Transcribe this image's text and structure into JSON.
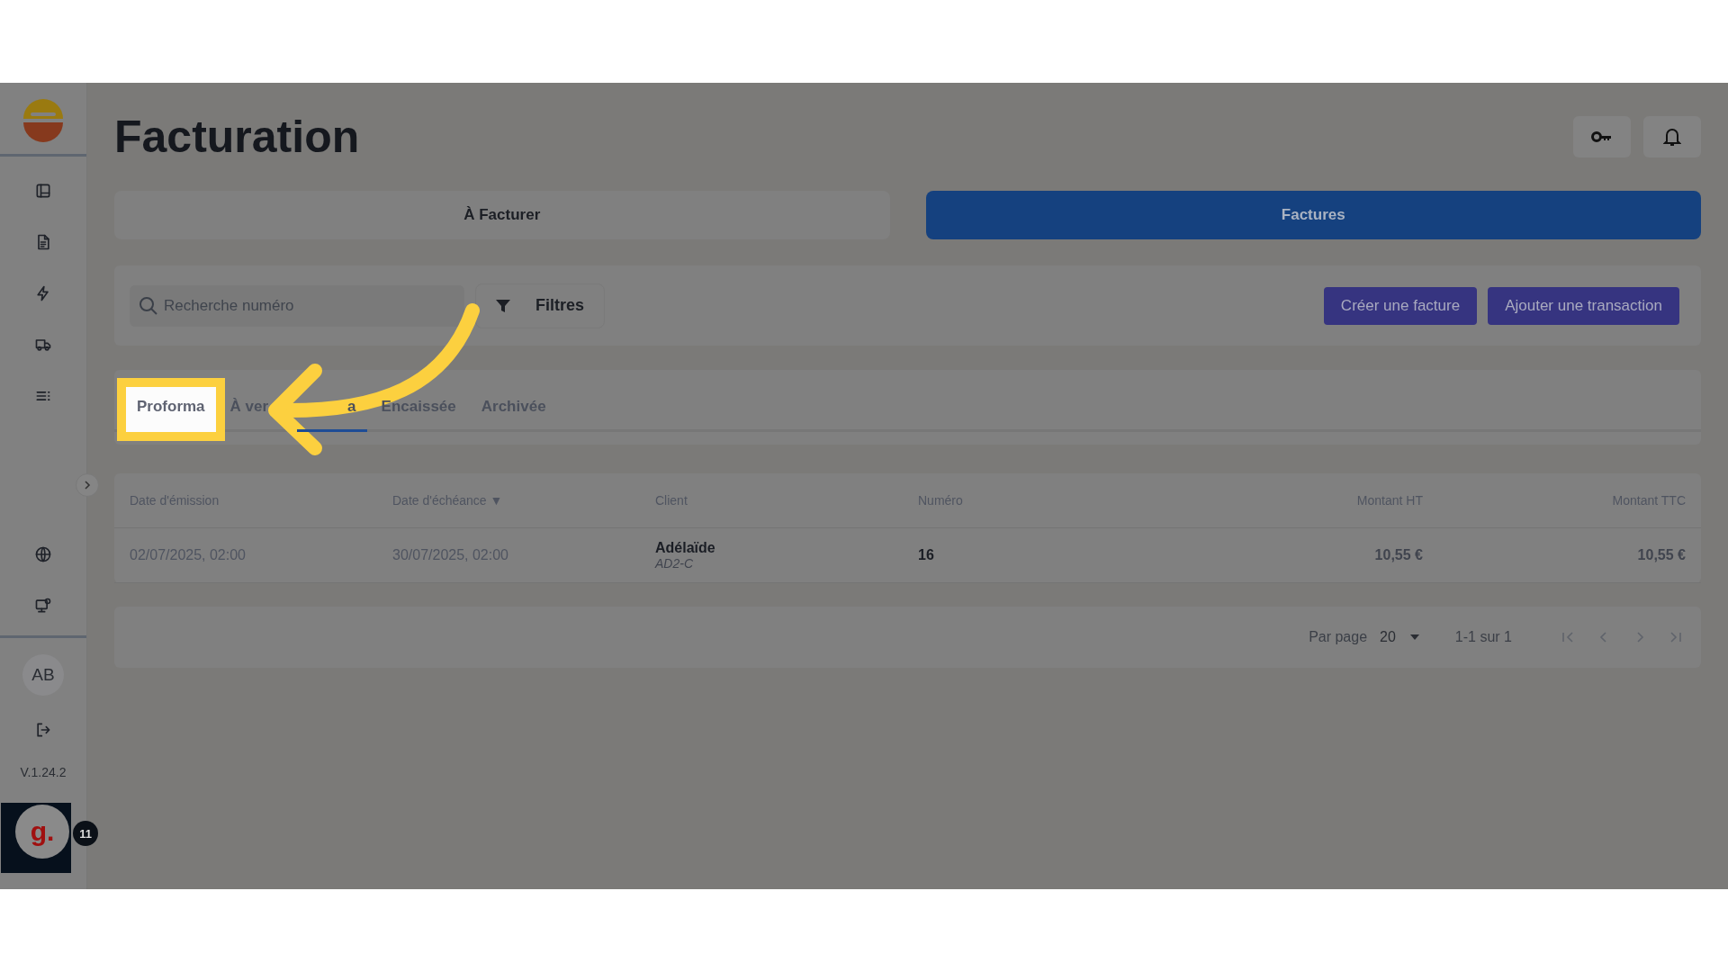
{
  "sidebar": {
    "avatar": "AB",
    "version": "V.1.24.2"
  },
  "widget": {
    "logo": "g.",
    "badge": "11"
  },
  "header": {
    "title": "Facturation"
  },
  "view_tabs": [
    {
      "label": "À Facturer",
      "selected": false
    },
    {
      "label": "Factures",
      "selected": true
    }
  ],
  "search": {
    "placeholder": "Recherche numéro"
  },
  "filter_button": {
    "label": "Filtres"
  },
  "actions": [
    "Créer une facture",
    "Ajouter une transaction"
  ],
  "status_tabs": [
    {
      "label": "Proforma",
      "selected": false,
      "highlighted": true
    },
    {
      "label": "À ver",
      "selected": false,
      "highlighted": false
    },
    {
      "label": "a",
      "selected": true,
      "highlighted": false
    },
    {
      "label": "Encaissée",
      "selected": false,
      "highlighted": false
    },
    {
      "label": "Archivée",
      "selected": false,
      "highlighted": false
    }
  ],
  "table": {
    "columns": [
      {
        "label": "Date d'émission"
      },
      {
        "label": "Date d'échéance",
        "sort_icon": "▼"
      },
      {
        "label": "Client"
      },
      {
        "label": "Numéro"
      },
      {
        "label": "Montant HT"
      },
      {
        "label": "Montant TTC"
      }
    ],
    "rows": [
      {
        "issued": "02/07/2025, 02:00",
        "due": "30/07/2025, 02:00",
        "client": "Adélaïde",
        "client_code": "AD2-C",
        "number": "16",
        "amount_ht": "10,55 €",
        "amount_ttc": "10,55 €"
      }
    ]
  },
  "pagination": {
    "per_page_label": "Par page",
    "per_page": "20",
    "range": "1-1 sur 1"
  }
}
